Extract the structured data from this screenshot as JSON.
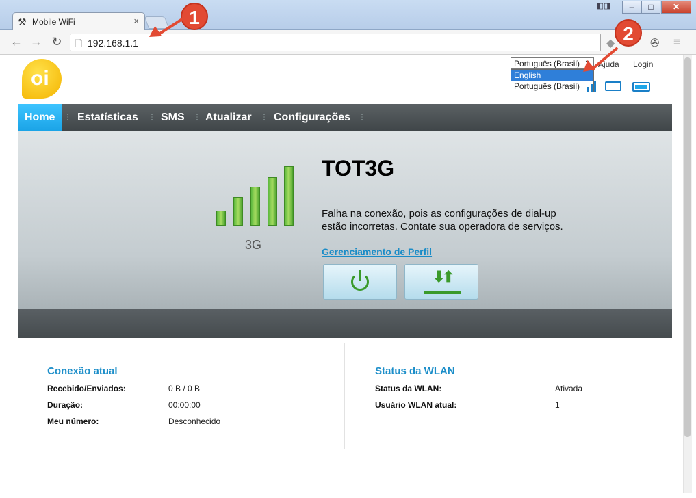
{
  "browser": {
    "tab_title": "Mobile WiFi",
    "tab_close": "×",
    "url": "192.168.1.1",
    "window_controls": {
      "minimize": "–",
      "maximize": "□",
      "close": "✕"
    },
    "nav_icons": {
      "back": "←",
      "forward": "→",
      "reload": "↻",
      "page": "🗋",
      "menu": "≡"
    }
  },
  "header": {
    "language_selected": "Português (Brasil)",
    "language_options": [
      "English",
      "Português (Brasil)"
    ],
    "help": "Ajuda",
    "login": "Login",
    "logo_text": "oi"
  },
  "nav": {
    "items": [
      "Home",
      "Estatísticas",
      "SMS",
      "Atualizar",
      "Configurações"
    ]
  },
  "hero": {
    "network_type": "3G",
    "network_name": "TOT3G",
    "message": "Falha na conexão, pois as configurações de dial-up estão incorretas. Contate sua operadora de serviços.",
    "profile_link": "Gerenciamento de Perfil"
  },
  "connection": {
    "title": "Conexão atual",
    "rows": [
      {
        "label": "Recebido/Enviados:",
        "value": "0 B /  0 B"
      },
      {
        "label": "Duração:",
        "value": "00:00:00"
      },
      {
        "label": "Meu número:",
        "value": "Desconhecido"
      }
    ]
  },
  "wlan": {
    "title": "Status da WLAN",
    "rows": [
      {
        "label": "Status da WLAN:",
        "value": "Ativada"
      },
      {
        "label": "Usuário WLAN atual:",
        "value": "1"
      }
    ]
  },
  "annotations": {
    "badge1": "1",
    "badge2": "2"
  },
  "colors": {
    "accent": "#1aa3e6",
    "link": "#1a8cc7",
    "signal": "#5cb83e",
    "annotation": "#e24a33"
  }
}
